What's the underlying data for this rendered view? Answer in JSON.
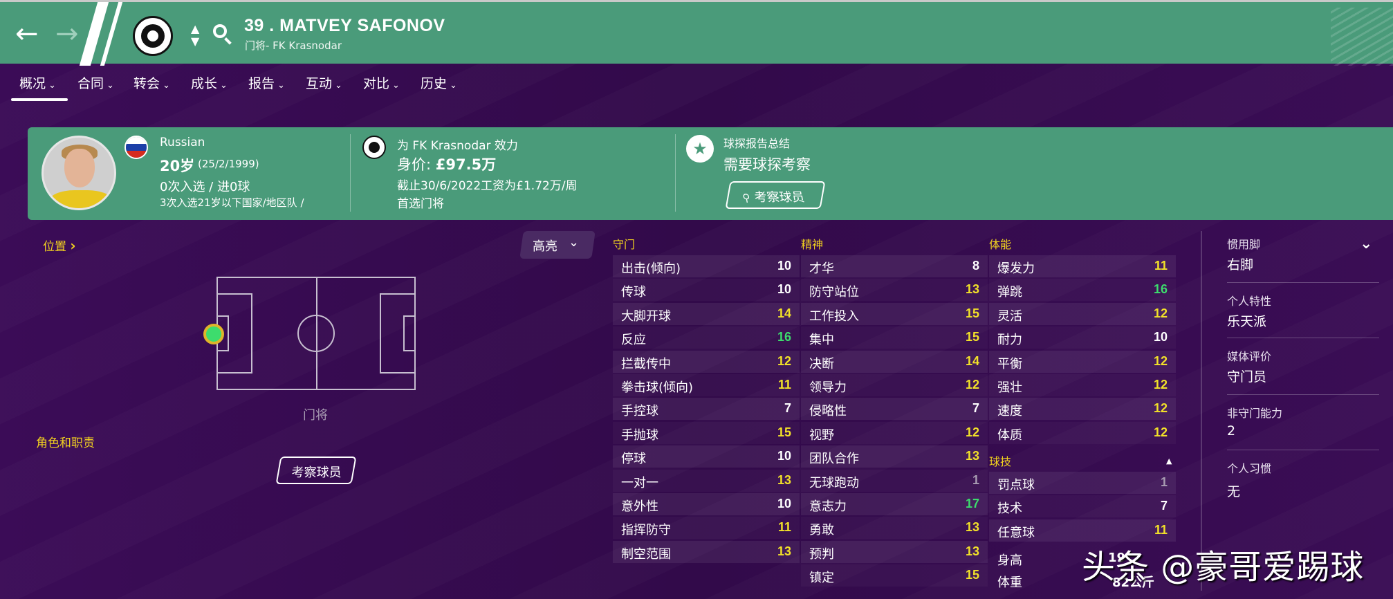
{
  "header": {
    "title": "39 . MATVEY SAFONOV",
    "subtitle": "门将- FK Krasnodar",
    "back_icon": "arrow-left-icon",
    "forward_icon": "arrow-right-icon",
    "updown_symbol": "⌃\n⌄",
    "colors": {
      "header": "#4a9b7a",
      "background": "#350a4e"
    }
  },
  "tabs": [
    {
      "label": "概况",
      "selected": true
    },
    {
      "label": "合同"
    },
    {
      "label": "转会"
    },
    {
      "label": "成长"
    },
    {
      "label": "报告"
    },
    {
      "label": "互动"
    },
    {
      "label": "对比"
    },
    {
      "label": "历史"
    }
  ],
  "chevron": "⌄",
  "info": {
    "nationality": "Russian",
    "age_big": "20岁",
    "dob": "(25/2/1999)",
    "caps": "0次入选 / 进0球",
    "youth_caps": "3次入选21岁以下国家/地区队 /",
    "club_line": "为 FK Krasnodar 效力",
    "value_label": "身价: ",
    "value": "£97.5万",
    "wage": "截止30/6/2022工资为£1.72万/周",
    "role_text": "首选门将",
    "scout_title": "球探报告总结",
    "scout_need": "需要球探考察",
    "scout_button": "考察球员"
  },
  "left": {
    "position_label": "位置",
    "position_arrow": "›",
    "highlight_button": "高亮",
    "position_name": "门将",
    "roles_label": "角色和职责",
    "scout_button": "考察球员"
  },
  "attributes": {
    "gk_title": "守门",
    "gk": [
      {
        "name": "出击(倾向)",
        "value": "10",
        "c": "w"
      },
      {
        "name": "传球",
        "value": "10",
        "c": "w"
      },
      {
        "name": "大脚开球",
        "value": "14",
        "c": "y"
      },
      {
        "name": "反应",
        "value": "16",
        "c": "g"
      },
      {
        "name": "拦截传中",
        "value": "12",
        "c": "y"
      },
      {
        "name": "拳击球(倾向)",
        "value": "11",
        "c": "y"
      },
      {
        "name": "手控球",
        "value": "7",
        "c": "w"
      },
      {
        "name": "手抛球",
        "value": "15",
        "c": "y"
      },
      {
        "name": "停球",
        "value": "10",
        "c": "w"
      },
      {
        "name": "一对一",
        "value": "13",
        "c": "y"
      },
      {
        "name": "意外性",
        "value": "10",
        "c": "w"
      },
      {
        "name": "指挥防守",
        "value": "11",
        "c": "y"
      },
      {
        "name": "制空范围",
        "value": "13",
        "c": "y"
      }
    ],
    "mental_title": "精神",
    "mental": [
      {
        "name": "才华",
        "value": "8",
        "c": "w"
      },
      {
        "name": "防守站位",
        "value": "13",
        "c": "y"
      },
      {
        "name": "工作投入",
        "value": "15",
        "c": "y"
      },
      {
        "name": "集中",
        "value": "15",
        "c": "y"
      },
      {
        "name": "决断",
        "value": "14",
        "c": "y"
      },
      {
        "name": "领导力",
        "value": "12",
        "c": "y"
      },
      {
        "name": "侵略性",
        "value": "7",
        "c": "w"
      },
      {
        "name": "视野",
        "value": "12",
        "c": "y"
      },
      {
        "name": "团队合作",
        "value": "13",
        "c": "y"
      },
      {
        "name": "无球跑动",
        "value": "1",
        "c": "gr"
      },
      {
        "name": "意志力",
        "value": "17",
        "c": "g"
      },
      {
        "name": "勇敢",
        "value": "13",
        "c": "y"
      },
      {
        "name": "预判",
        "value": "13",
        "c": "y"
      },
      {
        "name": "镇定",
        "value": "15",
        "c": "y"
      }
    ],
    "physical_title": "体能",
    "physical": [
      {
        "name": "爆发力",
        "value": "11",
        "c": "y"
      },
      {
        "name": "弹跳",
        "value": "16",
        "c": "g"
      },
      {
        "name": "灵活",
        "value": "12",
        "c": "y"
      },
      {
        "name": "耐力",
        "value": "10",
        "c": "w"
      },
      {
        "name": "平衡",
        "value": "12",
        "c": "y"
      },
      {
        "name": "强壮",
        "value": "12",
        "c": "y"
      },
      {
        "name": "速度",
        "value": "12",
        "c": "y"
      },
      {
        "name": "体质",
        "value": "12",
        "c": "y"
      }
    ],
    "technical_title": "球技",
    "technical_toggle": "▲",
    "technical": [
      {
        "name": "罚点球",
        "value": "1",
        "c": "gr"
      },
      {
        "name": "技术",
        "value": "7",
        "c": "w"
      },
      {
        "name": "任意球",
        "value": "11",
        "c": "y"
      }
    ],
    "height_label": "身高",
    "height_value": "19",
    "weight_label": "体重",
    "weight_value": "82公斤"
  },
  "right": {
    "foot_label": "惯用脚",
    "foot_value": "右脚",
    "collapse_icon": "⌄",
    "personality_label": "个人特性",
    "personality_value": "乐天派",
    "media_label": "媒体评价",
    "media_value": "守门员",
    "ability_label": "非守门能力",
    "ability_value": "2",
    "habits_label": "个人习惯",
    "habits_value": "无"
  },
  "watermark": "头条 @豪哥爱踢球",
  "colors": {
    "y": "#f2e129",
    "g": "#3ddc6d",
    "w": "#ffffff",
    "gr": "#a89cb2",
    "accent_yellow": "#f2d21f"
  }
}
